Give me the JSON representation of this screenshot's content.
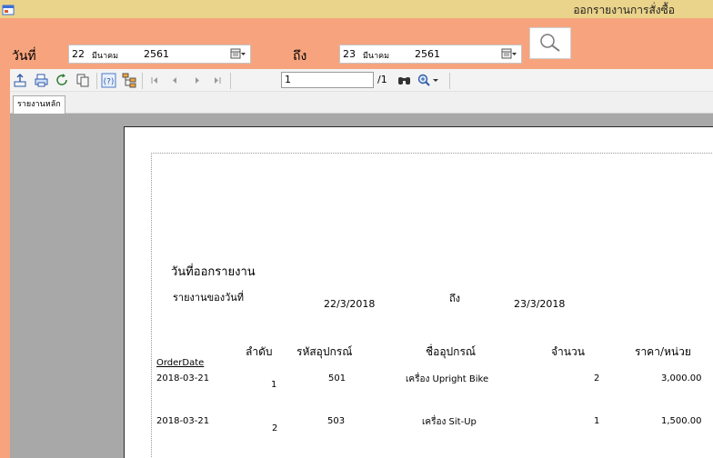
{
  "window": {
    "title": "ออกรายงานการสั่งซื้อ"
  },
  "filter": {
    "from_label": "วันที่",
    "from_day": "22",
    "from_month": "มีนาคม",
    "from_year": "2561",
    "to_label": "ถึง",
    "to_day": "23",
    "to_month": "มีนาคม",
    "to_year": "2561"
  },
  "viewer": {
    "page_current": "1",
    "page_total": "/1",
    "tab_label": "รายงานหลัก"
  },
  "report": {
    "heading": "วันที่ออกรายงาน",
    "range_label": "รายงานของวันที่",
    "range_from": "22/3/2018",
    "range_to_label": "ถึง",
    "range_to": "23/3/2018",
    "columns": [
      "OrderDate",
      "ลำดับ",
      "รหัสอุปกรณ์",
      "ชื่ออุปกรณ์",
      "จำนวน",
      "ราคา/หน่วย"
    ],
    "rows": [
      {
        "date": "2018-03-21",
        "seq": "1",
        "code": "501",
        "name": "เครื่อง Upright Bike",
        "qty": "2",
        "price": "3,000.00"
      },
      {
        "date": "2018-03-21",
        "seq": "2",
        "code": "503",
        "name": "เครื่อง Sit-Up",
        "qty": "1",
        "price": "1,500.00"
      }
    ]
  }
}
